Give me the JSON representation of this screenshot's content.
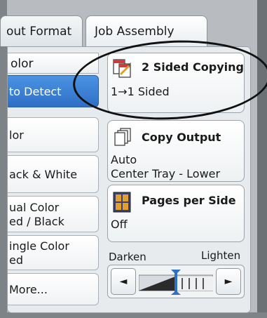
{
  "tabs": [
    {
      "label": "out Format"
    },
    {
      "label": "Job Assembly"
    }
  ],
  "color_mode": {
    "header": "olor",
    "options": [
      {
        "lines": [
          "to Detect"
        ],
        "selected": true
      },
      {
        "lines": [
          "lor"
        ],
        "selected": false
      },
      {
        "lines": [
          "ack & White"
        ],
        "selected": false
      },
      {
        "lines": [
          "ual Color",
          "ed / Black"
        ],
        "selected": false
      },
      {
        "lines": [
          "ingle Color",
          "ed"
        ],
        "selected": false
      },
      {
        "lines": [
          "More..."
        ],
        "selected": false
      }
    ]
  },
  "two_sided": {
    "title": "2 Sided Copying",
    "value": "1→1 Sided",
    "icon": "duplex-copy-icon"
  },
  "copy_output": {
    "title": "Copy Output",
    "value_lines": [
      "Auto",
      "Center Tray - Lower"
    ],
    "icon": "stacked-pages-icon"
  },
  "pages_per_side": {
    "title": "Pages per Side",
    "value": "Off",
    "icon": "four-up-pages-icon"
  },
  "density": {
    "darken_label": "Darken",
    "lighten_label": "Lighten",
    "left_arrow": "◄",
    "right_arrow": "►",
    "level": 0.5
  },
  "colors": {
    "selected": "#3a7fd6",
    "annotation": "#111111"
  }
}
